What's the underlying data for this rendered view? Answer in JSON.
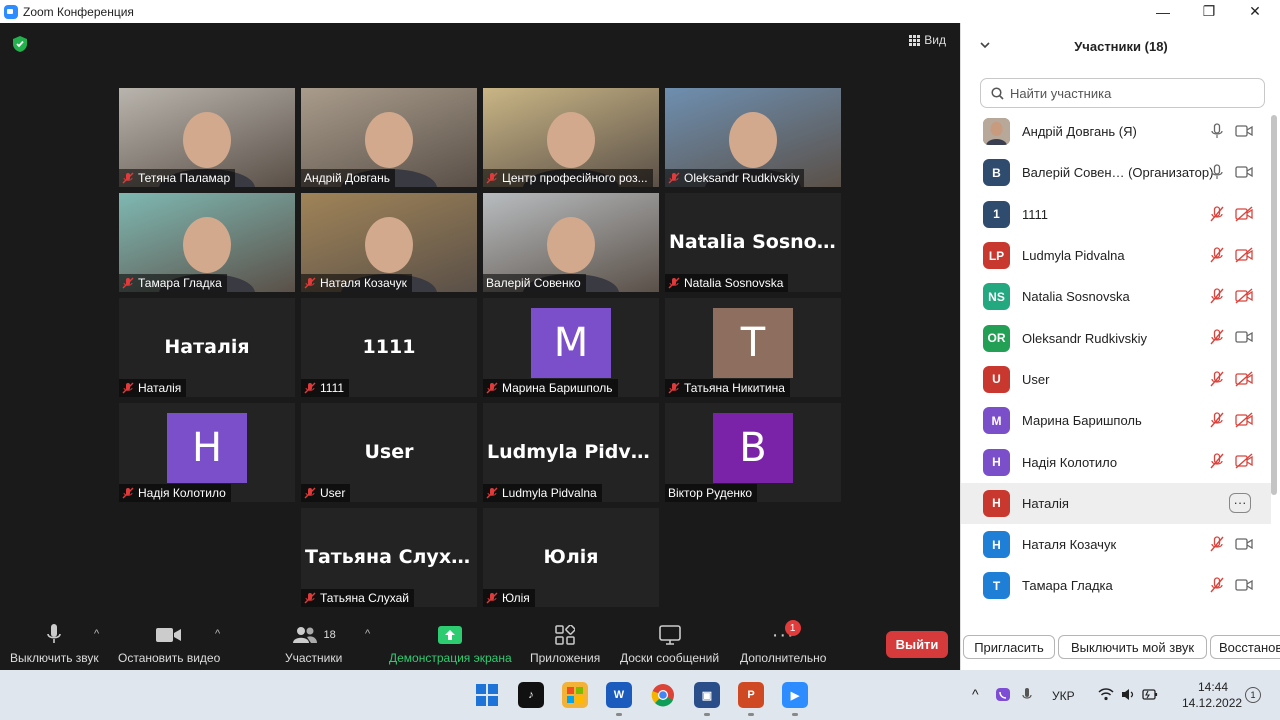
{
  "window": {
    "title": "Zoom Конференция",
    "minimize": "—",
    "maximize": "❐",
    "close": "✕"
  },
  "stage": {
    "view_label": "Вид",
    "tiles": [
      {
        "name": "Тетяна Паламар",
        "kind": "video",
        "bg": "#b9b4ad",
        "muted": true
      },
      {
        "name": "Андрій Довгань",
        "kind": "video",
        "bg": "#a99c8c",
        "muted": false
      },
      {
        "name": "Центр професійного роз...",
        "kind": "video",
        "bg": "#c9b585",
        "muted": true
      },
      {
        "name": "Oleksandr Rudkivskiy",
        "kind": "video",
        "bg": "#6e8fb0",
        "muted": true
      },
      {
        "name": "Тамара Гладка",
        "kind": "video",
        "bg": "#7fb8b2",
        "muted": true
      },
      {
        "name": "Наталя Козачук",
        "kind": "video",
        "bg": "#a08458",
        "muted": true
      },
      {
        "name": "Валерій Совенко",
        "kind": "video",
        "bg": "#b8bcbf",
        "muted": false,
        "active": true
      },
      {
        "name": "Natalia Sosnovska",
        "kind": "text",
        "display": "Natalia  Sosnovs...",
        "muted": true
      },
      {
        "name": "Наталія",
        "kind": "text",
        "display": "Наталія",
        "muted": true
      },
      {
        "name": "1111",
        "kind": "text",
        "display": "1111",
        "muted": true
      },
      {
        "name": "Марина Баришполь",
        "kind": "avatar",
        "letter": "M",
        "color": "#7b4fc9",
        "muted": true
      },
      {
        "name": "Татьяна Никитина",
        "kind": "avatar",
        "letter": "T",
        "color": "#8e6e5e",
        "muted": true
      },
      {
        "name": "Надія Колотило",
        "kind": "avatar",
        "letter": "H",
        "color": "#7b4fc9",
        "muted": true
      },
      {
        "name": "User",
        "kind": "text",
        "display": "User",
        "muted": true
      },
      {
        "name": "Ludmyla Pidvalna",
        "kind": "text",
        "display": "Ludmyla Pidvalna",
        "muted": true
      },
      {
        "name": "Віктор Руденко",
        "kind": "avatar",
        "letter": "B",
        "color": "#7a22a8",
        "muted": false
      },
      {
        "name": "Татьяна Слухай",
        "kind": "text",
        "display": "Татьяна Слухай",
        "muted": true
      },
      {
        "name": "Юлія",
        "kind": "text",
        "display": "Юлія",
        "muted": true
      }
    ]
  },
  "toolbar": {
    "mute_label": "Выключить звук",
    "video_label": "Остановить видео",
    "participants_label": "Участники",
    "participants_count": "18",
    "share_label": "Демонстрация экрана",
    "apps_label": "Приложения",
    "whiteboard_label": "Доски сообщений",
    "more_label": "Дополнительно",
    "more_badge": "1",
    "leave_label": "Выйти"
  },
  "panel": {
    "title": "Участники (18)",
    "search_placeholder": "Найти участника",
    "participants": [
      {
        "name": "Андрій Довгань (Я)",
        "initials": "",
        "color": "#8a7a6a",
        "photo": true,
        "mic": "on",
        "cam": "on"
      },
      {
        "name": "Валерій Совен…  (Организатор)",
        "initials": "B",
        "color": "#2f4b6e",
        "mic": "on",
        "cam": "on"
      },
      {
        "name": "1111",
        "initials": "1",
        "color": "#2f4b6e",
        "mic": "off",
        "cam": "off"
      },
      {
        "name": "Ludmyla Pidvalna",
        "initials": "LP",
        "color": "#c8382f",
        "mic": "off",
        "cam": "off"
      },
      {
        "name": "Natalia Sosnovska",
        "initials": "NS",
        "color": "#23a87f",
        "mic": "off",
        "cam": "off"
      },
      {
        "name": "Oleksandr Rudkivskiy",
        "initials": "OR",
        "color": "#23a055",
        "mic": "off",
        "cam": "on"
      },
      {
        "name": "User",
        "initials": "U",
        "color": "#c8382f",
        "mic": "off",
        "cam": "off"
      },
      {
        "name": "Марина Баришполь",
        "initials": "M",
        "color": "#7b4fc9",
        "mic": "off",
        "cam": "off"
      },
      {
        "name": "Надія Колотило",
        "initials": "H",
        "color": "#7b4fc9",
        "mic": "off",
        "cam": "off"
      },
      {
        "name": "Наталія",
        "initials": "H",
        "color": "#c8382f",
        "mic": "",
        "cam": "",
        "highlight": true,
        "more": "···"
      },
      {
        "name": "Наталя Козачук",
        "initials": "H",
        "color": "#1f7fd6",
        "mic": "off",
        "cam": "on"
      },
      {
        "name": "Тамара Гладка",
        "initials": "T",
        "color": "#1f7fd6",
        "mic": "off",
        "cam": "on"
      }
    ],
    "footer": {
      "invite": "Пригласить",
      "mute_me": "Выключить мой звук",
      "restore": "Восстанов"
    }
  },
  "taskbar": {
    "apps": [
      {
        "name": "windows-start",
        "color": "#1e73d8",
        "text": ""
      },
      {
        "name": "tiktok",
        "color": "#111111",
        "text": "♪"
      },
      {
        "name": "microsoft-store",
        "color": "#f2b338",
        "text": ""
      },
      {
        "name": "word",
        "color": "#1b5bbd",
        "text": "W"
      },
      {
        "name": "chrome",
        "color": "#e0a020",
        "text": ""
      },
      {
        "name": "save-app",
        "color": "#2a4e8a",
        "text": "▣"
      },
      {
        "name": "powerpoint",
        "color": "#cf4a22",
        "text": "P"
      },
      {
        "name": "zoom",
        "color": "#2d8cff",
        "text": "▶"
      }
    ],
    "lang": "УКР",
    "time": "14:44",
    "date": "14.12.2022",
    "notif_count": "1"
  }
}
